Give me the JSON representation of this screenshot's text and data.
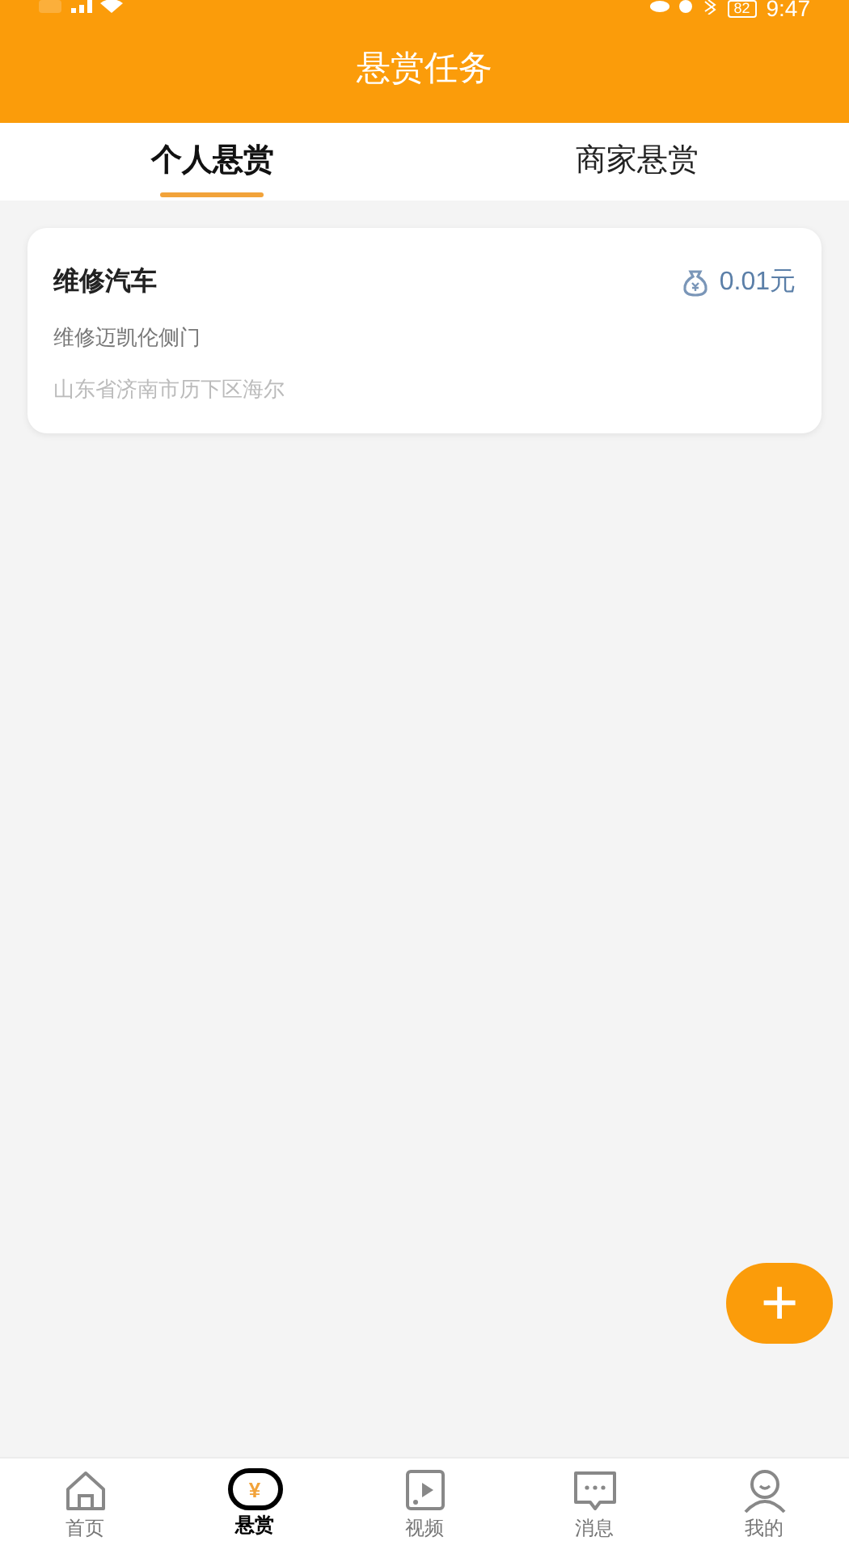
{
  "status_bar": {
    "battery": "82",
    "time": "9:47"
  },
  "header": {
    "title": "悬赏任务"
  },
  "tabs": [
    {
      "label": "个人悬赏",
      "selected": true
    },
    {
      "label": "商家悬赏",
      "selected": false
    }
  ],
  "tasks": [
    {
      "title": "维修汽车",
      "reward": "0.01元",
      "description": "维修迈凯伦侧门",
      "address": "山东省济南市历下区海尔"
    }
  ],
  "fab": {
    "symbol": "+"
  },
  "nav": [
    {
      "kind": "home",
      "label": "首页",
      "selected": false
    },
    {
      "kind": "reward",
      "label": "悬赏",
      "selected": true,
      "symbol": "¥"
    },
    {
      "kind": "video",
      "label": "视频",
      "selected": false
    },
    {
      "kind": "message",
      "label": "消息",
      "selected": false
    },
    {
      "kind": "profile",
      "label": "我的",
      "selected": false
    }
  ]
}
